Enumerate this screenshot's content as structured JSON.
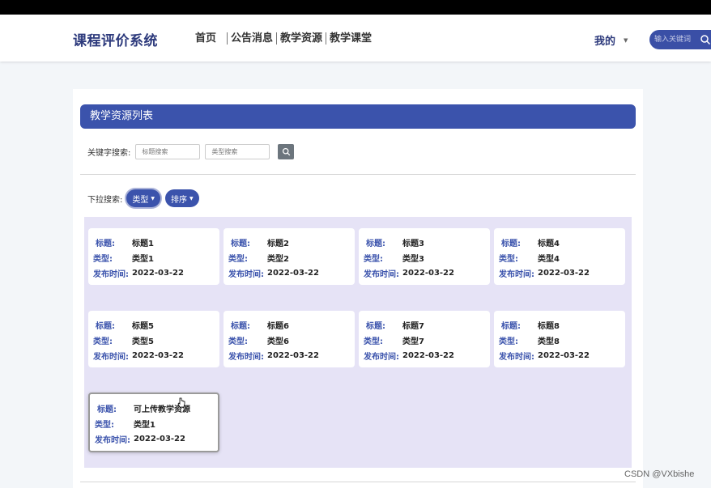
{
  "nav": {
    "brand": "课程评价系统",
    "items": [
      "首页",
      "公告消息",
      "教学资源",
      "教学课堂"
    ],
    "user_menu": "我的",
    "search_placeholder": "输入关键词"
  },
  "panel": {
    "title": "教学资源列表",
    "keyword_search": {
      "label": "关键字搜索:",
      "title_placeholder": "标题搜索",
      "type_placeholder": "类型搜索"
    },
    "dropdown_search": {
      "label": "下拉搜索:",
      "type_button": "类型",
      "sort_button": "排序"
    },
    "field_labels": {
      "title": "标题:",
      "type": "类型:",
      "date": "发布时间:"
    },
    "cards": [
      {
        "title": "标题1",
        "type": "类型1",
        "date": "2022-03-22"
      },
      {
        "title": "标题2",
        "type": "类型2",
        "date": "2022-03-22"
      },
      {
        "title": "标题3",
        "type": "类型3",
        "date": "2022-03-22"
      },
      {
        "title": "标题4",
        "type": "类型4",
        "date": "2022-03-22"
      },
      {
        "title": "标题5",
        "type": "类型5",
        "date": "2022-03-22"
      },
      {
        "title": "标题6",
        "type": "类型6",
        "date": "2022-03-22"
      },
      {
        "title": "标题7",
        "type": "类型7",
        "date": "2022-03-22"
      },
      {
        "title": "标题8",
        "type": "类型8",
        "date": "2022-03-22"
      },
      {
        "title": "可上传教学资源",
        "type": "类型1",
        "date": "2022-03-22"
      }
    ]
  },
  "watermark": "CSDN @VXbishe",
  "colors": {
    "brand": "#2d3a7c",
    "accent": "#3b53ac",
    "grid_bg": "#e6e3f6"
  },
  "icons": {
    "search": "magnifier-icon",
    "caret": "caret-down-icon"
  }
}
